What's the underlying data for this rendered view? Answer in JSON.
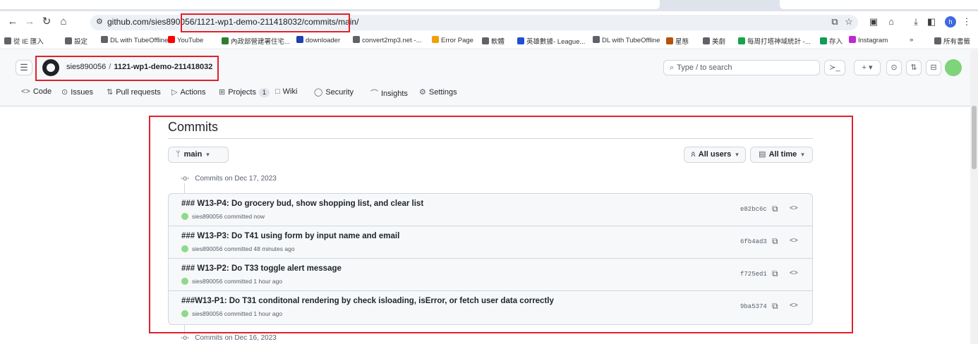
{
  "browser": {
    "url": "github.com/sies890056/1121-wp1-demo-211418032/commits/main/",
    "profile_initial": "h",
    "bookmarks": [
      {
        "label": "從 IE 匯入",
        "color": "#5f6368"
      },
      {
        "label": "設定",
        "color": "#5f6368"
      },
      {
        "label": "DL with TubeOffline",
        "color": "#5f6368"
      },
      {
        "label": "YouTube",
        "color": "#ff0000"
      },
      {
        "label": "內政部營建署住宅...",
        "color": "#2e7d32"
      },
      {
        "label": "downloader",
        "color": "#1e40af"
      },
      {
        "label": "convert2mp3.net -...",
        "color": "#5f6368"
      },
      {
        "label": "Error Page",
        "color": "#f59e0b"
      },
      {
        "label": "軟體",
        "color": "#5f6368"
      },
      {
        "label": "英雄數據- League...",
        "color": "#1d4ed8"
      },
      {
        "label": "DL with TubeOffline",
        "color": "#5f6368"
      },
      {
        "label": "星態",
        "color": "#b45309"
      },
      {
        "label": "美劇",
        "color": "#5f6368"
      },
      {
        "label": "每周打塔神域統計 -...",
        "color": "#16a34a"
      },
      {
        "label": "存入",
        "color": "#0f9d58"
      },
      {
        "label": "Instagram",
        "color": "#c026d3"
      },
      {
        "label": "»",
        "color": "#5f6368"
      },
      {
        "label": "所有書籤",
        "color": "#5f6368"
      }
    ]
  },
  "header": {
    "owner": "sies890056",
    "separator": "/",
    "repo": "1121-wp1-demo-211418032",
    "search_placeholder": "Type / to search"
  },
  "repo_nav": [
    {
      "label": "Code",
      "icon": "code-icon",
      "glyph": "<>"
    },
    {
      "label": "Issues",
      "icon": "issue-icon",
      "glyph": "⊙"
    },
    {
      "label": "Pull requests",
      "icon": "pull-request-icon",
      "glyph": "⇅"
    },
    {
      "label": "Actions",
      "icon": "play-icon",
      "glyph": "▷"
    },
    {
      "label": "Projects",
      "icon": "table-icon",
      "glyph": "⊞",
      "count": "1"
    },
    {
      "label": "Wiki",
      "icon": "book-icon",
      "glyph": "□"
    },
    {
      "label": "Security",
      "icon": "shield-icon",
      "glyph": "◯"
    },
    {
      "label": "Insights",
      "icon": "graph-icon",
      "glyph": "⌒"
    },
    {
      "label": "Settings",
      "icon": "gear-icon",
      "glyph": "⚙"
    }
  ],
  "commits_page": {
    "title": "Commits",
    "branch": "main",
    "users_filter": "All users",
    "time_filter": "All time",
    "groups": [
      {
        "date_label": "Commits on Dec 17, 2023"
      },
      {
        "date_label": "Commits on Dec 16, 2023"
      }
    ],
    "commits": [
      {
        "message": "### W13-P4: Do grocery bud, show shopping list, and clear list",
        "author": "sies890056",
        "when": "committed now",
        "sha": "e82bc6c"
      },
      {
        "message": "### W13-P3: Do T41 using form by input name and email",
        "author": "sies890056",
        "when": "committed 48 minutes ago",
        "sha": "6fb4ad3"
      },
      {
        "message": "### W13-P2: Do T33 toggle alert message",
        "author": "sies890056",
        "when": "committed 1 hour ago",
        "sha": "f725ed1"
      },
      {
        "message": "###W13-P1: Do T31 conditonal rendering by check isloading, isError, or fetch user data correctly",
        "author": "sies890056",
        "when": "committed 1 hour ago",
        "sha": "9ba5374"
      }
    ]
  }
}
